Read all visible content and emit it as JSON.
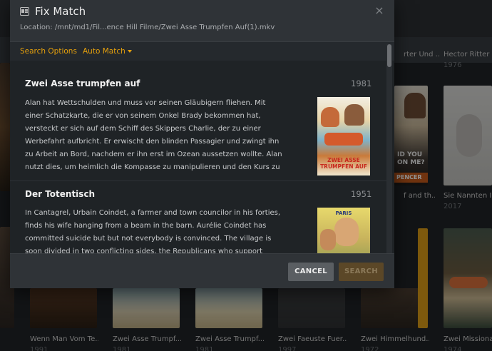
{
  "modal": {
    "title": "Fix Match",
    "close_glyph": "×",
    "location": "Location: /mnt/md1/Fil...ence Hill Filme/Zwei Asse Trumpfen Auf(1).mkv",
    "title_icon": "match-icon",
    "tabs": [
      {
        "label": "Search Options"
      },
      {
        "label": "Auto Match"
      }
    ],
    "results": [
      {
        "title": "Zwei Asse trumpfen auf",
        "year": "1981",
        "description": "Alan hat Wettschulden und muss vor seinen Gläubigern fliehen. Mit einer Schatzkarte, die er von seinem Onkel Brady bekommen hat, versteckt er sich auf dem Schiff des Skippers Charlie, der zu einer Werbefahrt aufbricht. Er erwischt den blinden Passagier und zwingt ihn zu Arbeit an Bord, nachdem er ihn erst im Ozean aussetzen wollte. Alan nutzt dies, um heimlich die Kompasse zu manipulieren und den Kurs zu verändern, so",
        "poster_text": "ZWEI ASSE TRUMPFEN AUF"
      },
      {
        "title": "Der Totentisch",
        "year": "1951",
        "description": "In Cantagrel, Urbain Coindet, a farmer and town councilor in his forties, finds his wife hanging from a beam in the barn. Aurélie Coindet has committed suicide but but not everybody is convinced. The village is soon divided in two conflicting sides, the Republicans who support Urbain and",
        "poster_text": "PARIS"
      }
    ],
    "buttons": {
      "cancel": "CANCEL",
      "search": "SEARCH"
    }
  },
  "background": {
    "cards": [
      {
        "title": "Wenn Man Vom Te...",
        "year": "1991"
      },
      {
        "title": "Zwei Asse Trumpf...",
        "year": "1981"
      },
      {
        "title": "Zwei Asse Trumpf...",
        "year": "1981"
      },
      {
        "title": "Zwei Faeuste Fuer...",
        "year": "1997"
      },
      {
        "title": "Zwei Himmelhund...",
        "year": "1972"
      },
      {
        "title": "Zwei Missionar...",
        "year": "1974"
      },
      {
        "title": "rter Und ...",
        "year": ""
      },
      {
        "title": "Hector Ritter C...",
        "year": "1976"
      },
      {
        "title": "f and th...",
        "year": ""
      },
      {
        "title": "Sie Nannten Ih...",
        "year": "2017"
      }
    ],
    "poster_text": {
      "youme": "ID YOU ON ME?",
      "spencer": "PENCER"
    }
  },
  "colors": {
    "accent": "#e5a00d",
    "modal_bg": "#2f3337",
    "body_bg": "#1f2326"
  }
}
